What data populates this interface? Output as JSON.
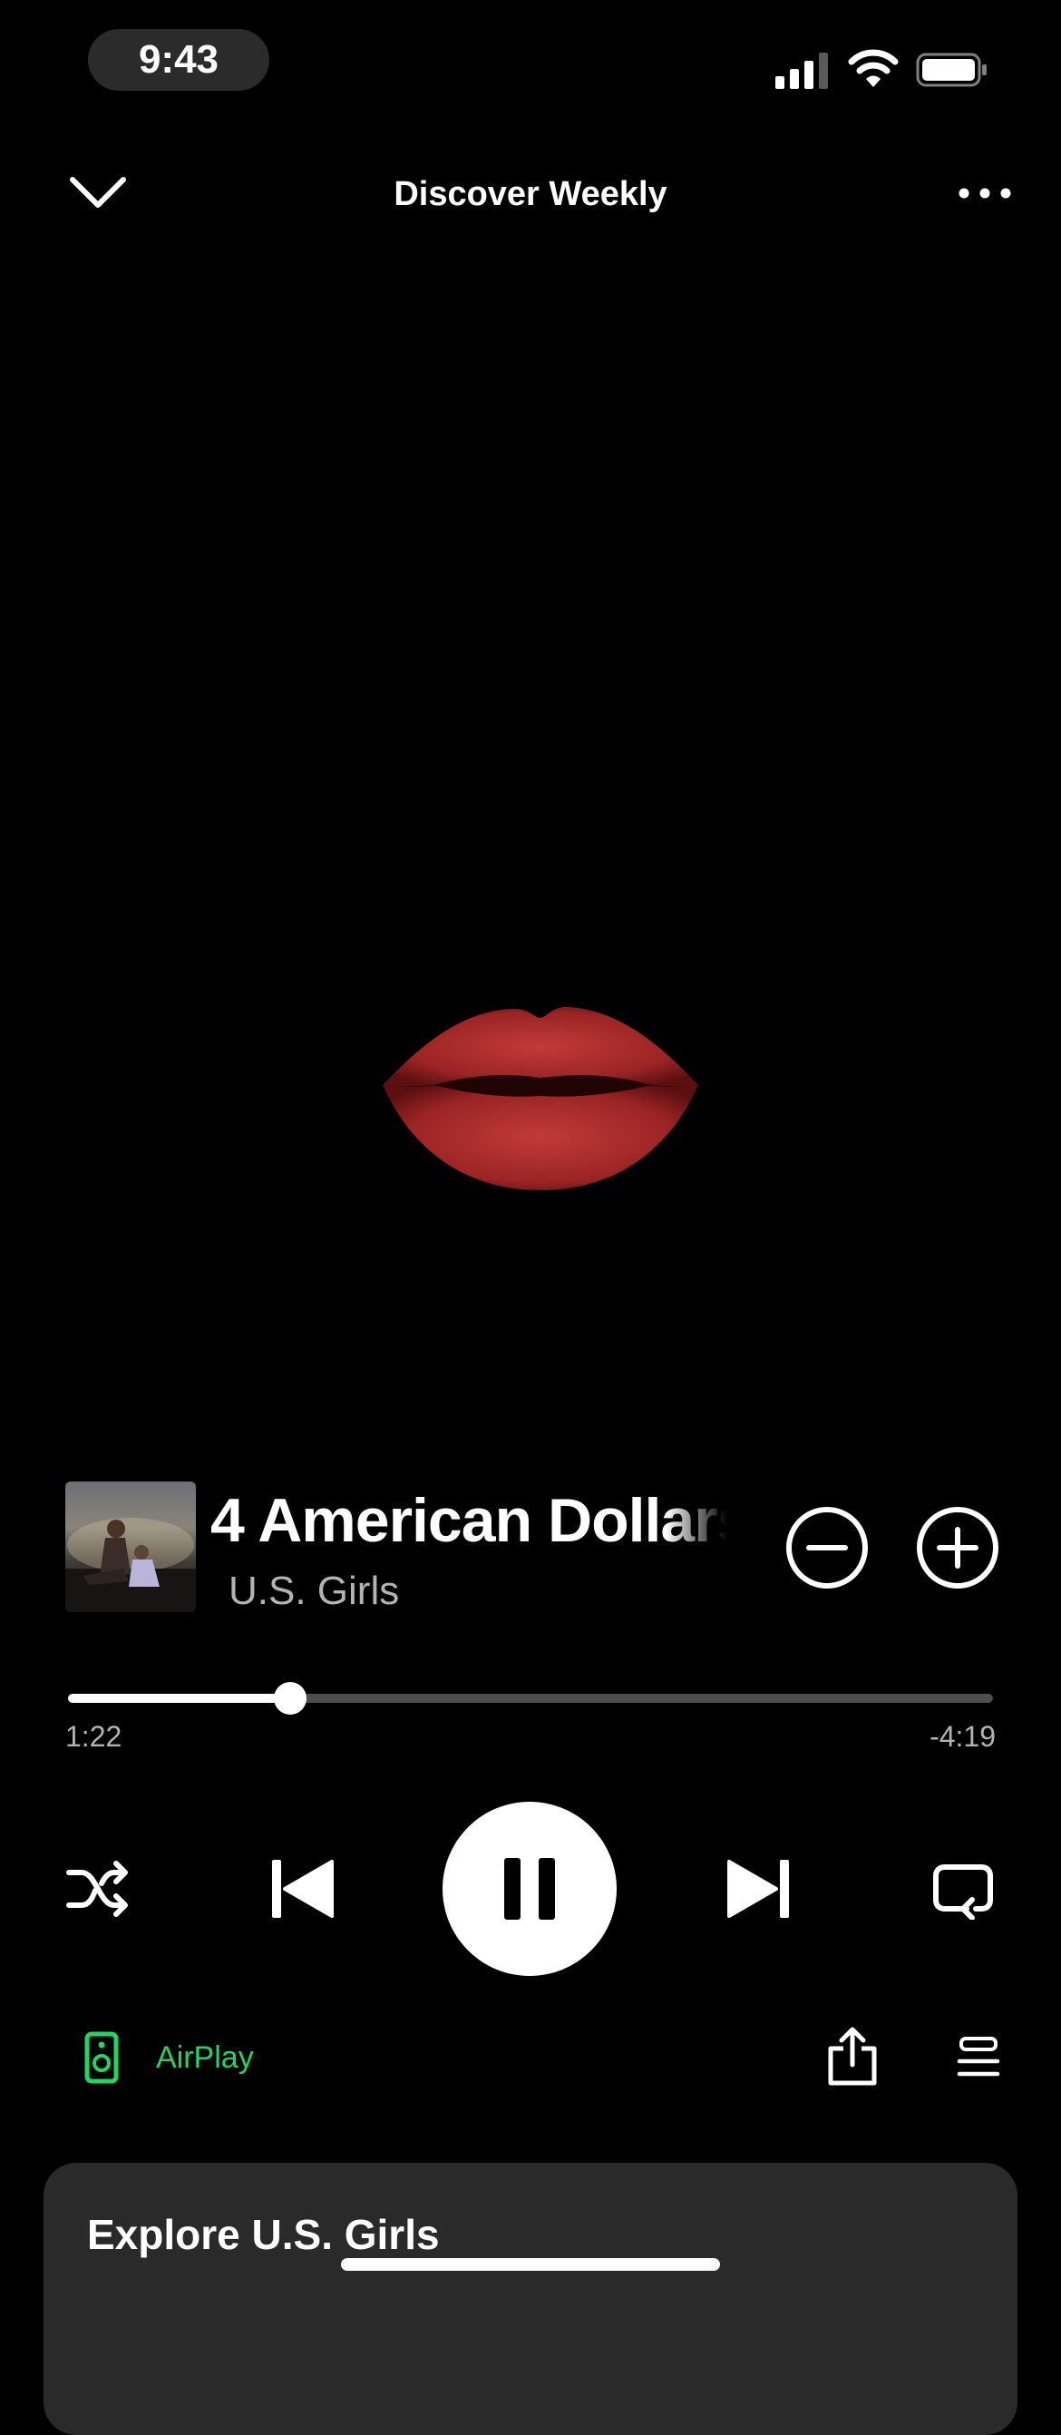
{
  "status_bar": {
    "time": "9:43",
    "icons": [
      "signal-icon",
      "wifi-icon",
      "battery-icon"
    ]
  },
  "header": {
    "title": "Discover Weekly",
    "left_icon": "chevron-down-icon",
    "right_icon": "more-icon"
  },
  "artwork": {
    "icon": "lips-icon"
  },
  "track": {
    "title": "4 American Dollars",
    "artist": "U.S. Girls"
  },
  "progress": {
    "elapsed": "1:22",
    "remaining": "-4:19",
    "fraction": 0.24
  },
  "controls": {
    "shuffle": "shuffle-icon",
    "previous": "skip-back-icon",
    "play_state": "pause-icon",
    "next": "skip-forward-icon",
    "repeat": "repeat-icon"
  },
  "device": {
    "label": "AirPlay",
    "icon": "speaker-icon"
  },
  "explore": {
    "title": "Explore U.S. Girls"
  },
  "colors": {
    "background": "#000000",
    "accent": "#1ed760",
    "secondary_text": "#b3b3b3",
    "card": "#2a2a2a"
  }
}
